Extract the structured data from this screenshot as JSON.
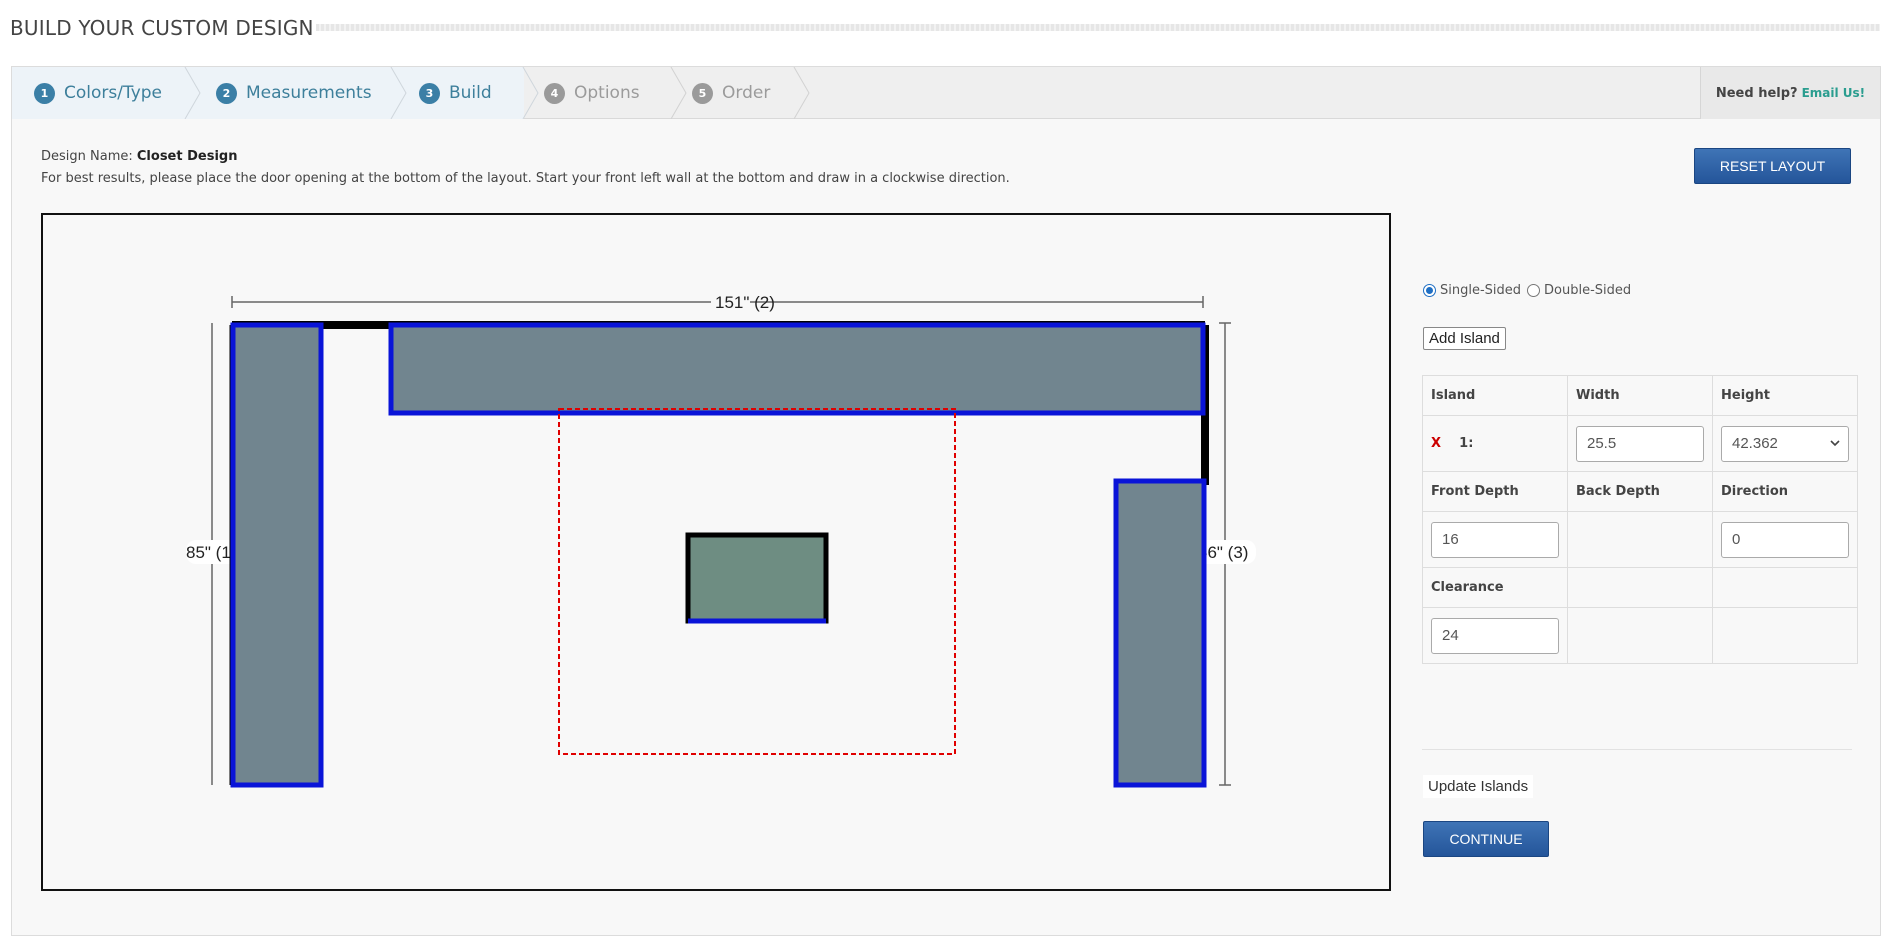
{
  "page_title": "BUILD YOUR CUSTOM DESIGN",
  "steps": [
    {
      "number": "1",
      "label": "Colors/Type",
      "state": "done"
    },
    {
      "number": "2",
      "label": "Measurements",
      "state": "done"
    },
    {
      "number": "3",
      "label": "Build",
      "state": "current"
    },
    {
      "number": "4",
      "label": "Options",
      "state": "todo"
    },
    {
      "number": "5",
      "label": "Order",
      "state": "todo"
    }
  ],
  "help": {
    "text": "Need help?",
    "link": "Email Us!"
  },
  "design": {
    "name_label": "Design Name:",
    "name_value": "Closet Design",
    "instructions": "For best results, please place the door opening at the bottom of the layout. Start your front left wall at the bottom and draw in a clockwise direction."
  },
  "buttons": {
    "reset": "RESET LAYOUT",
    "add_island": "Add Island",
    "update_islands": "Update Islands",
    "continue": "CONTINUE"
  },
  "sided_options": {
    "single": "Single-Sided",
    "double": "Double-Sided",
    "selected": "Single-Sided"
  },
  "layout_labels": {
    "top_wall": "151\" (2)",
    "left_wall": "85\" (1)",
    "right_wall": "56\" (3)"
  },
  "island_table": {
    "headers": {
      "island": "Island",
      "width": "Width",
      "height": "Height",
      "front_depth": "Front Depth",
      "back_depth": "Back Depth",
      "direction": "Direction",
      "clearance": "Clearance"
    },
    "row": {
      "remove": "X",
      "island_label": "1:",
      "width": "25.5",
      "height": "42.362",
      "front_depth": "16",
      "direction": "0",
      "clearance": "24"
    }
  },
  "colors": {
    "accent_blue": "#2a5ea3",
    "cabinet_fill": "#71858f",
    "cabinet_border": "#0a14d8",
    "island_fill": "#6e8d82",
    "clearance_dash": "#e00000"
  }
}
